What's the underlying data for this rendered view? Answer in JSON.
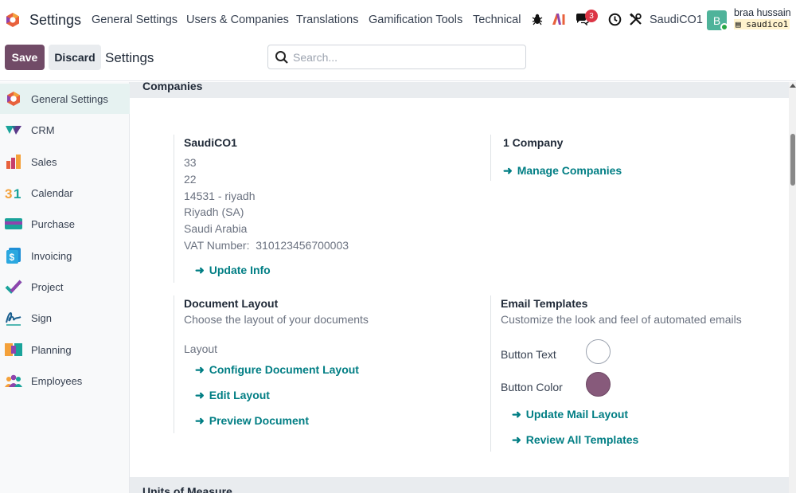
{
  "topbar": {
    "app_title": "Settings",
    "nav": [
      {
        "label": "General Settings"
      },
      {
        "label": "Users & Companies"
      },
      {
        "label": "Translations"
      },
      {
        "label": "Gamification Tools"
      },
      {
        "label": "Technical"
      }
    ],
    "message_count": "3",
    "company": "SaudiCO1",
    "user_initial": "B",
    "user_name": "braa hussain",
    "db_name": "saudico1"
  },
  "control": {
    "save_label": "Save",
    "discard_label": "Discard",
    "title": "Settings",
    "search_placeholder": "Search..."
  },
  "sidebar": {
    "items": [
      {
        "label": "General Settings",
        "icon": "odoo-logo-icon"
      },
      {
        "label": "CRM",
        "icon": "crm-icon"
      },
      {
        "label": "Sales",
        "icon": "sales-chart-icon"
      },
      {
        "label": "Calendar",
        "icon": "calendar-31-icon"
      },
      {
        "label": "Purchase",
        "icon": "purchase-card-icon"
      },
      {
        "label": "Invoicing",
        "icon": "invoice-icon"
      },
      {
        "label": "Project",
        "icon": "checkmark-icon"
      },
      {
        "label": "Sign",
        "icon": "signature-icon"
      },
      {
        "label": "Planning",
        "icon": "planning-icon"
      },
      {
        "label": "Employees",
        "icon": "employees-icon"
      }
    ]
  },
  "companies": {
    "section_title": "Companies",
    "company_name": "SaudiCO1",
    "address_lines": [
      "33",
      "22",
      "14531 - riyadh",
      "Riyadh (SA)",
      "Saudi Arabia"
    ],
    "vat_label": "VAT Number:",
    "vat_value": "310123456700003",
    "update_info": "Update Info",
    "company_count": "1 Company",
    "manage_companies": "Manage Companies"
  },
  "document_layout": {
    "title": "Document Layout",
    "description": "Choose the layout of your documents",
    "layout_label": "Layout",
    "configure": "Configure Document Layout",
    "edit": "Edit Layout",
    "preview": "Preview Document"
  },
  "email_templates": {
    "title": "Email Templates",
    "description": "Customize the look and feel of automated emails",
    "button_text_label": "Button Text",
    "button_text_color": "#ffffff",
    "button_color_label": "Button Color",
    "button_color": "#875a7b",
    "update_mail_layout": "Update Mail Layout",
    "review_templates": "Review All Templates"
  },
  "units": {
    "section_title": "Units of Measure"
  },
  "colors": {
    "brand": "#714b67",
    "link": "#017e84"
  }
}
